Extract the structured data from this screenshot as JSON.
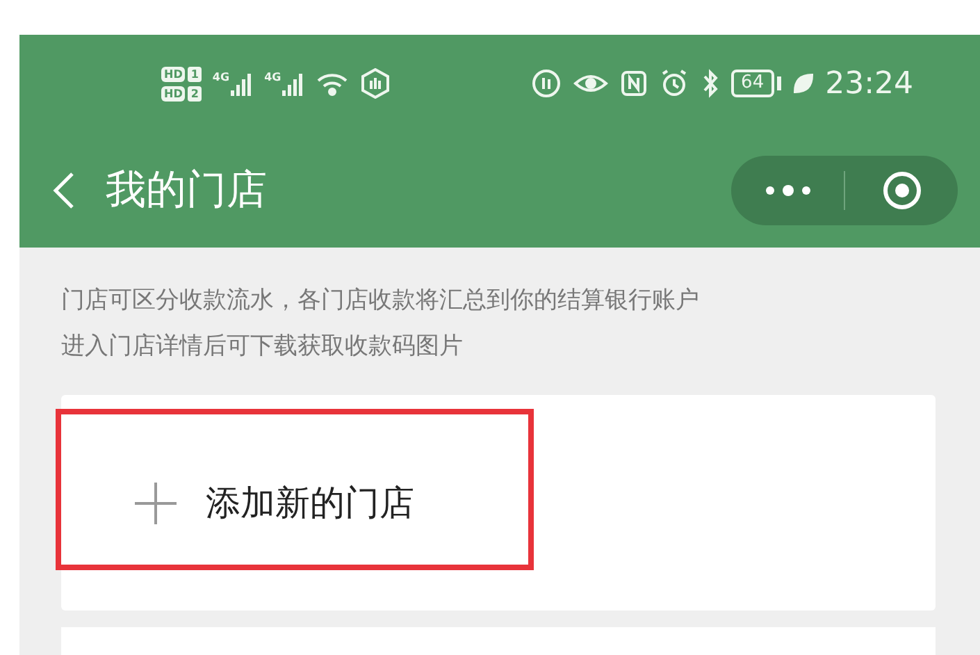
{
  "status_bar": {
    "sims": [
      {
        "badge": "HD",
        "slot": "1"
      },
      {
        "badge": "HD",
        "slot": "2"
      }
    ],
    "networks": [
      "4G",
      "4G"
    ],
    "battery": "64",
    "time": "23:24"
  },
  "header": {
    "title": "我的门店"
  },
  "notice": [
    "门店可区分收款流水，各门店收款将汇总到你的结算银行账户",
    "进入门店详情后可下载获取收款码图片"
  ],
  "add_store": {
    "label": "添加新的门店",
    "highlighted": true
  }
}
